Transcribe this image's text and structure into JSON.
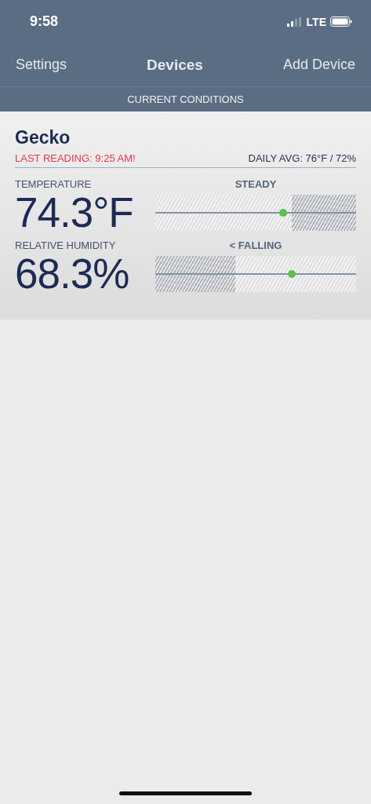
{
  "status_bar": {
    "time": "9:58",
    "network": "LTE"
  },
  "nav": {
    "left": "Settings",
    "title": "Devices",
    "right": "Add Device"
  },
  "section_header": "CURRENT CONDITIONS",
  "device": {
    "name": "Gecko",
    "last_reading": "LAST READING: 9:25 AM!",
    "daily_avg": "DAILY AVG: 76°F / 72%",
    "readings": [
      {
        "label": "TEMPERATURE",
        "value": "74.3°F",
        "trend": "STEADY",
        "kind": "high",
        "level": 0.637
      },
      {
        "label": "RELATIVE HUMIDITY",
        "value": "68.3%",
        "trend": "< FALLING",
        "kind": "low",
        "level": 0.68
      }
    ]
  }
}
